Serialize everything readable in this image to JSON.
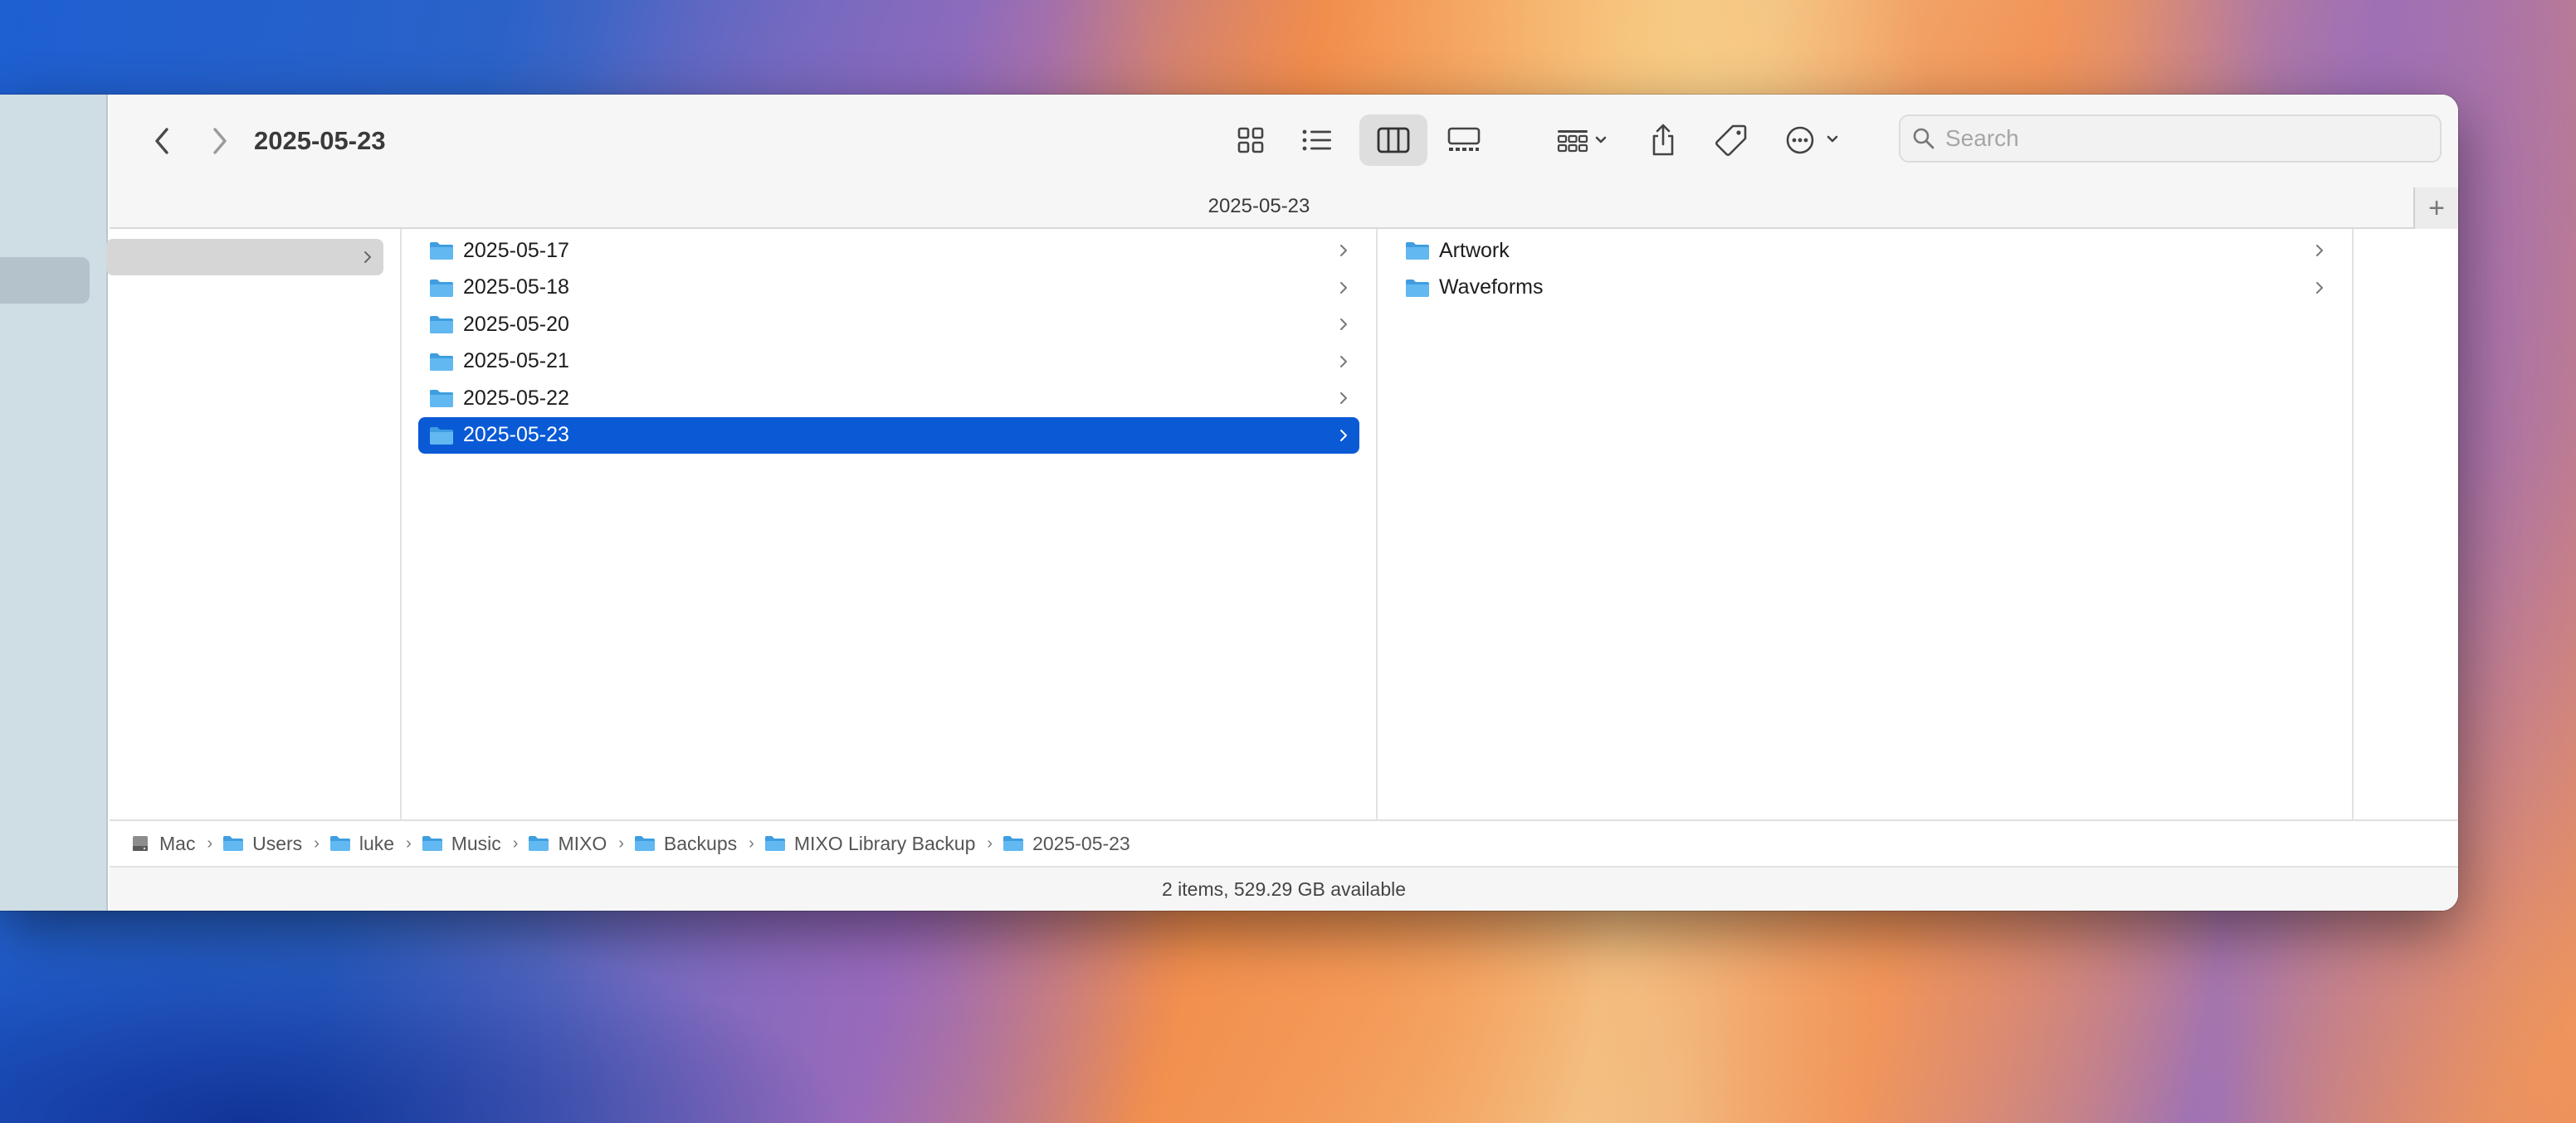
{
  "window": {
    "title": "2025-05-23",
    "tab_title": "2025-05-23",
    "new_tab_label": "+"
  },
  "search": {
    "placeholder": "Search"
  },
  "columns": {
    "parent_folders": [
      {
        "label": "2025-05-17"
      },
      {
        "label": "2025-05-18"
      },
      {
        "label": "2025-05-20"
      },
      {
        "label": "2025-05-21"
      },
      {
        "label": "2025-05-22"
      },
      {
        "label": "2025-05-23",
        "selected": true
      }
    ],
    "contents": [
      {
        "label": "Artwork"
      },
      {
        "label": "Waveforms"
      }
    ]
  },
  "pathbar": [
    "Mac",
    "Users",
    "luke",
    "Music",
    "MIXO",
    "Backups",
    "MIXO Library Backup",
    "2025-05-23"
  ],
  "status": "2 items, 529.29 GB available",
  "colors": {
    "selection": "#0a5ad6",
    "folder": "#5db4ee"
  },
  "icons": {
    "back": "chevron-left-icon",
    "forward": "chevron-right-icon",
    "icon_view": "grid-icon",
    "list_view": "list-icon",
    "column_view": "columns-icon",
    "gallery_view": "gallery-icon",
    "group": "group-icon",
    "share": "share-icon",
    "tag": "tag-icon",
    "more": "ellipsis-circle-icon"
  }
}
